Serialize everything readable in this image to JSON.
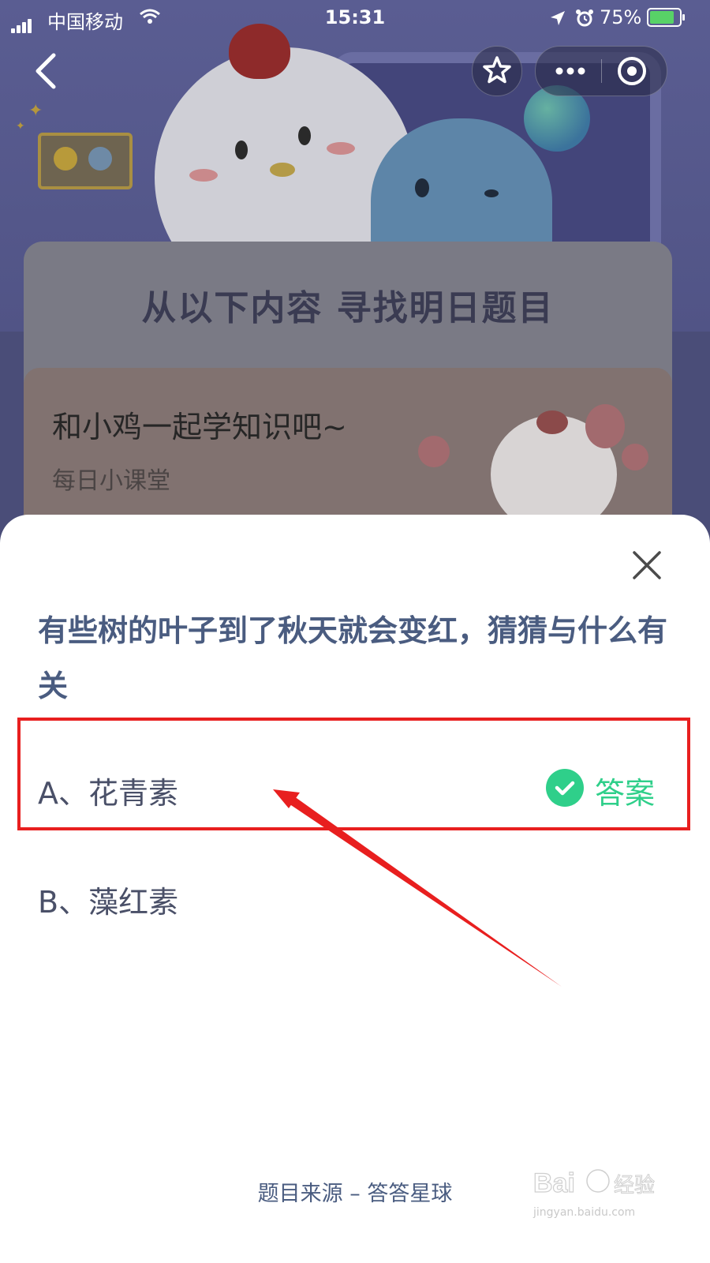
{
  "status_bar": {
    "carrier": "中国移动",
    "time": "15:31",
    "battery_pct": "75%"
  },
  "background_page": {
    "panel_heading": "从以下内容 寻找明日题目",
    "course_title": "和小鸡一起学知识吧~",
    "course_subtitle": "每日小课堂"
  },
  "quiz": {
    "question": "有些树的叶子到了秋天就会变红，猜猜与什么有关",
    "options": [
      {
        "label": "A、花青素",
        "is_answer": true
      },
      {
        "label": "B、藻红素",
        "is_answer": false
      }
    ],
    "answer_tag": "答案",
    "source": "题目来源 – 答答星球"
  },
  "annotations": {
    "highlight_color": "#e81f1f",
    "answer_color": "#2fcf8a"
  },
  "watermark": {
    "logo": "Bai经验",
    "url": "jingyan.baidu.com"
  },
  "icons": {
    "back": "chevron-left-icon",
    "favorite": "star-icon",
    "more": "more-dots-icon",
    "close_mini_program": "target-icon",
    "close_sheet": "close-icon",
    "answer": "check-circle-icon"
  }
}
